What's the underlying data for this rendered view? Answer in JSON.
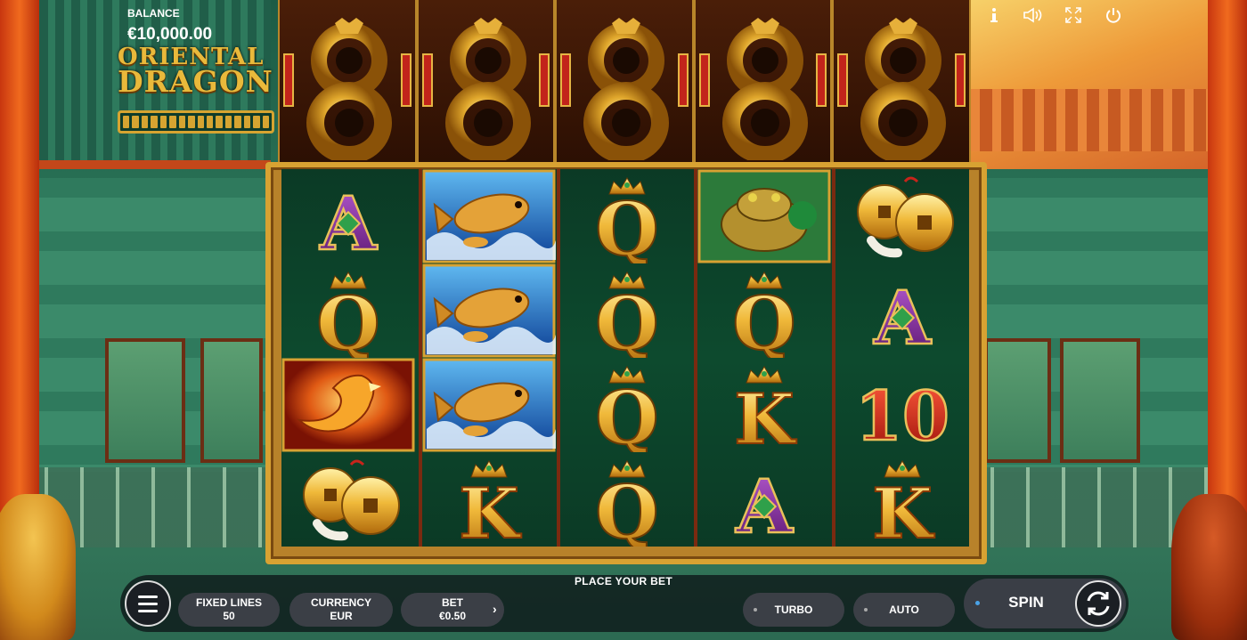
{
  "game": {
    "balance_label": "BALANCE",
    "balance_value": "€10,000.00",
    "logo_line1": "ORIENTAL",
    "logo_line2": "DRAGON"
  },
  "top_icons": [
    "info-icon",
    "sound-icon",
    "fullscreen-icon",
    "power-icon"
  ],
  "reels": [
    [
      "A",
      "Q",
      "PHOENIX",
      "COINS"
    ],
    [
      "FISH",
      "FISH",
      "FISH",
      "K"
    ],
    [
      "Q",
      "Q",
      "Q",
      "Q"
    ],
    [
      "TOAD",
      "Q",
      "K",
      "A"
    ],
    [
      "COINS",
      "A",
      "10",
      "K"
    ]
  ],
  "controls": {
    "place_bet": "PLACE YOUR BET",
    "fixed_lines_label": "FIXED LINES",
    "fixed_lines_value": "50",
    "currency_label": "CURRENCY",
    "currency_value": "EUR",
    "bet_label": "BET",
    "bet_value": "€0.50",
    "turbo_label": "TURBO",
    "auto_label": "AUTO",
    "spin_label": "SPIN"
  },
  "colors": {
    "gold": "#e2b23a",
    "reel_bg": "#0d4a2e",
    "purple": "#7c2c9a",
    "red": "#c8241b",
    "spin_accent": "#4aa3e8"
  }
}
